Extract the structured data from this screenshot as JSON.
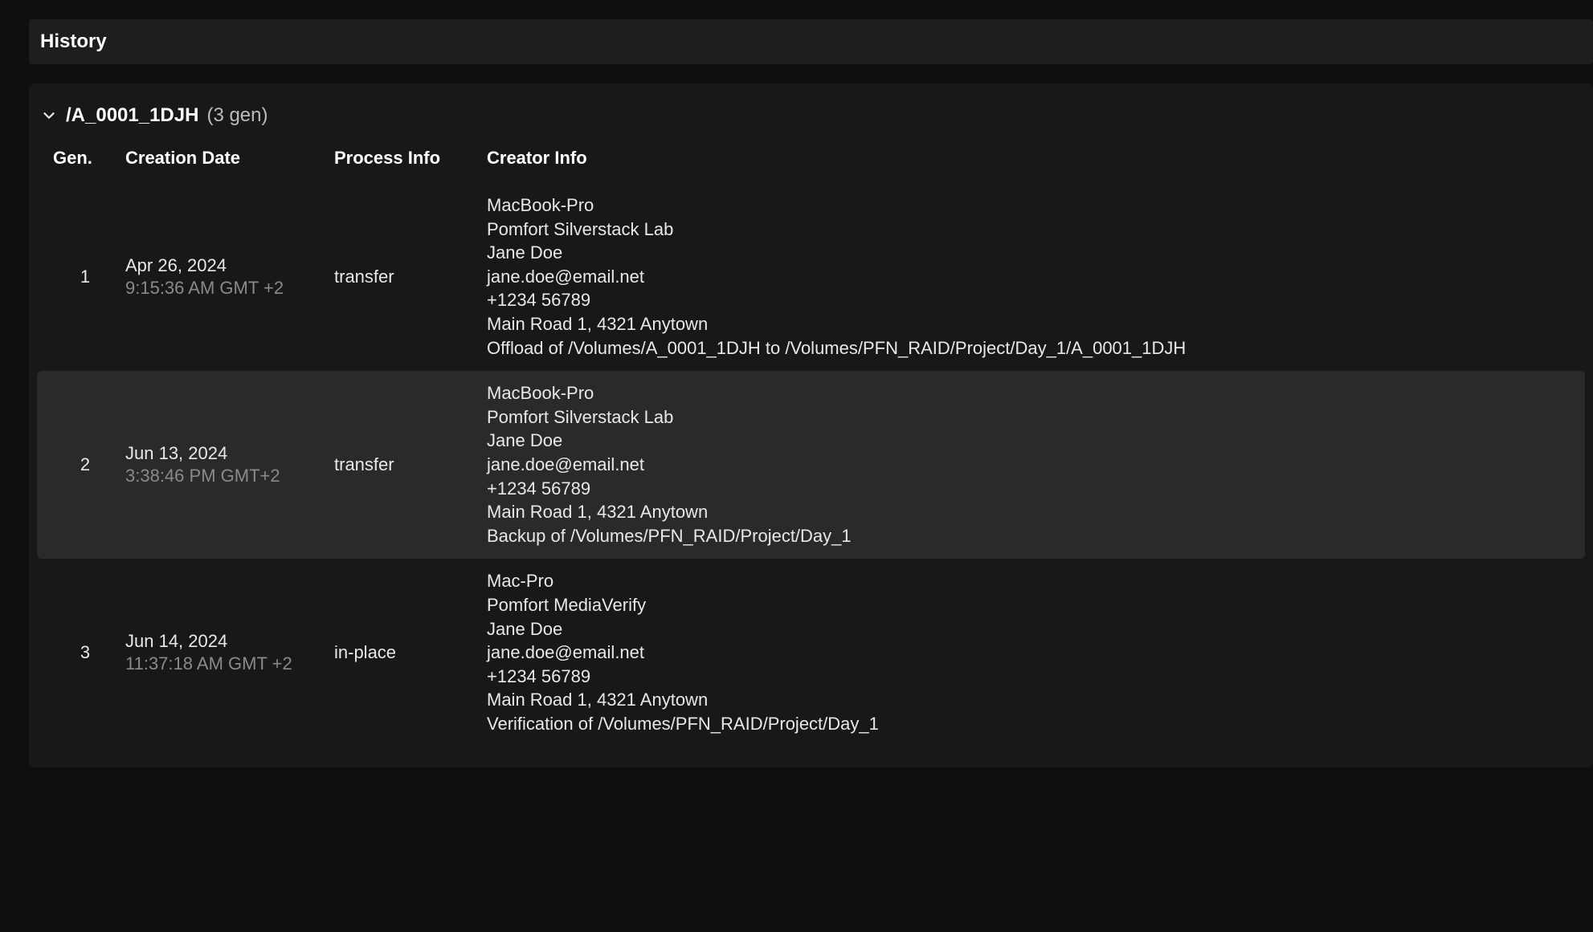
{
  "header": {
    "title": "History"
  },
  "folder": {
    "name": "/A_0001_1DJH",
    "count_label": "(3 gen)"
  },
  "columns": {
    "gen": "Gen.",
    "creation_date": "Creation Date",
    "process_info": "Process Info",
    "creator_info": "Creator Info"
  },
  "rows": [
    {
      "gen": "1",
      "date": "Apr 26, 2024",
      "time": "9:15:36 AM GMT +2",
      "process": "transfer",
      "creator": {
        "machine": "MacBook-Pro",
        "app": "Pomfort Silverstack Lab",
        "name": "Jane Doe",
        "email": "jane.doe@email.net",
        "phone": "+1234 56789",
        "address": "Main Road 1, 4321 Anytown",
        "action": "Offload of /Volumes/A_0001_1DJH to /Volumes/PFN_RAID/Project/Day_1/A_0001_1DJH"
      }
    },
    {
      "gen": "2",
      "date": "Jun 13, 2024",
      "time": "3:38:46 PM GMT+2",
      "process": "transfer",
      "creator": {
        "machine": "MacBook-Pro",
        "app": "Pomfort Silverstack Lab",
        "name": "Jane Doe",
        "email": "jane.doe@email.net",
        "phone": "+1234 56789",
        "address": "Main Road 1, 4321 Anytown",
        "action": "Backup of /Volumes/PFN_RAID/Project/Day_1"
      }
    },
    {
      "gen": "3",
      "date": "Jun 14, 2024",
      "time": "11:37:18 AM GMT +2",
      "process": "in-place",
      "creator": {
        "machine": "Mac-Pro",
        "app": "Pomfort MediaVerify",
        "name": "Jane Doe",
        "email": "jane.doe@email.net",
        "phone": "+1234 56789",
        "address": "Main Road 1, 4321 Anytown",
        "action": "Verification of /Volumes/PFN_RAID/Project/Day_1"
      }
    }
  ]
}
